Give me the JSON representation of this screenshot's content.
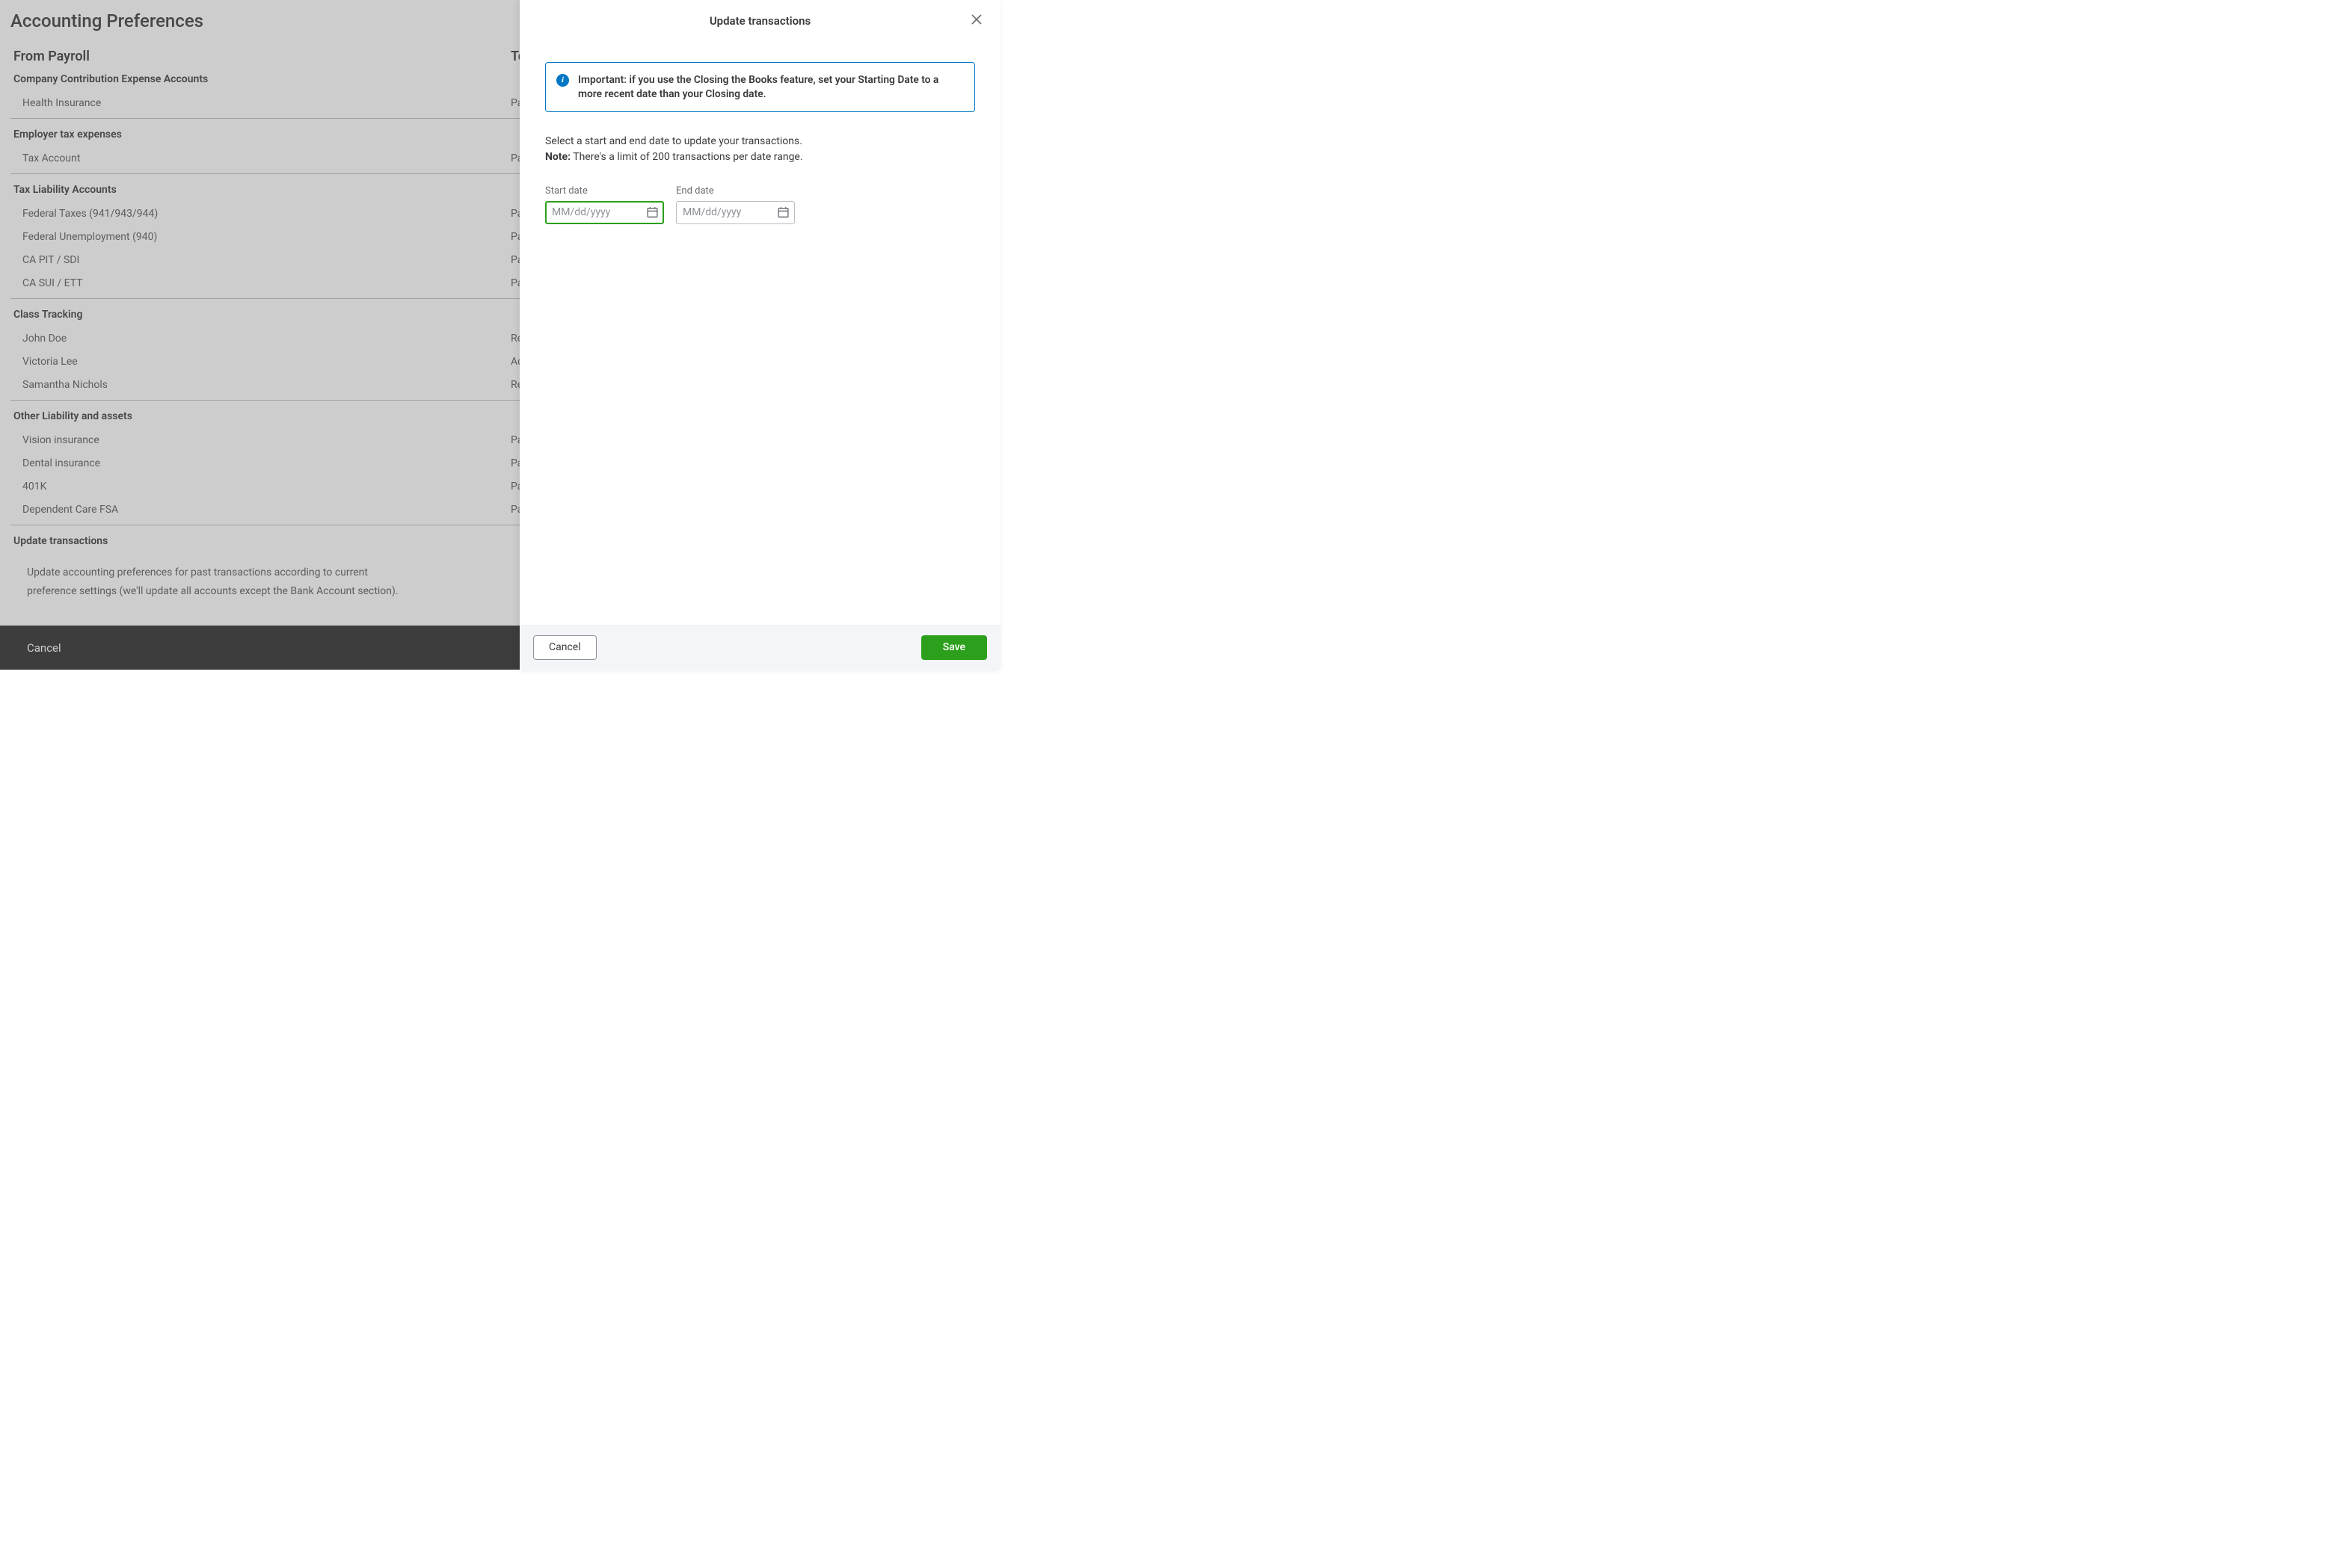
{
  "page": {
    "title": "Accounting Preferences",
    "col_left": "From Payroll",
    "col_right": "To",
    "footer_cancel": "Cancel"
  },
  "sections": {
    "company_contribution": {
      "heading": "Company Contribution Expense Accounts",
      "rows": [
        {
          "left": "Health Insurance",
          "right": "Pa"
        }
      ]
    },
    "employer_tax": {
      "heading": "Employer tax expenses",
      "rows": [
        {
          "left": "Tax Account",
          "right": "Pa"
        }
      ]
    },
    "tax_liability": {
      "heading": "Tax Liability Accounts",
      "rows": [
        {
          "left": "Federal Taxes (941/943/944)",
          "right": "Pa"
        },
        {
          "left": "Federal Unemployment (940)",
          "right": "Pa"
        },
        {
          "left": "CA PIT / SDI",
          "right": "Pa"
        },
        {
          "left": "CA SUI / ETT",
          "right": "Pa"
        }
      ]
    },
    "class_tracking": {
      "heading": "Class Tracking",
      "rows": [
        {
          "left": "John Doe",
          "right": "Re"
        },
        {
          "left": "Victoria Lee",
          "right": "Ac"
        },
        {
          "left": "Samantha Nichols",
          "right": "Re"
        }
      ]
    },
    "other_liability": {
      "heading": "Other Liability and assets",
      "rows": [
        {
          "left": "Vision insurance",
          "right": "Pa"
        },
        {
          "left": "Dental insurance",
          "right": "Pa"
        },
        {
          "left": "401K",
          "right": "Pa"
        },
        {
          "left": "Dependent Care FSA",
          "right": "Pa"
        }
      ]
    },
    "update_transactions": {
      "heading": "Update transactions",
      "description": "Update accounting preferences for past transactions according to current preference settings (we'll update all accounts except the Bank Account section)."
    }
  },
  "panel": {
    "title": "Update transactions",
    "info_text_bold": "Important: if you use the Closing the Books feature, set your Starting Date to a more recent date than your Closing date.",
    "instruction_line1": "Select a start and end date to update your transactions.",
    "note_label": "Note:",
    "note_text": " There's a limit of 200 transactions per date range.",
    "start_label": "Start date",
    "end_label": "End date",
    "placeholder": "MM/dd/yyyy",
    "cancel": "Cancel",
    "save": "Save"
  }
}
